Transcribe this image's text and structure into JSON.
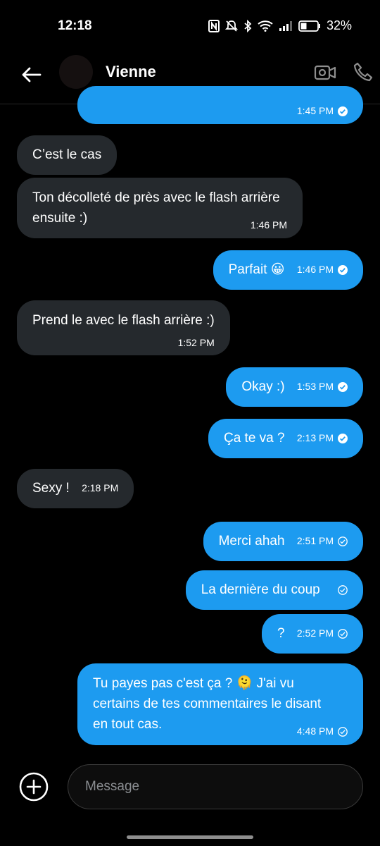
{
  "status": {
    "time": "12:18",
    "battery": "32%"
  },
  "header": {
    "contact_name": "Vienne"
  },
  "messages": [
    {
      "dir": "out",
      "text": "",
      "time": "1:45 PM",
      "read": true
    },
    {
      "dir": "in",
      "text": "C’est le cas",
      "time": ""
    },
    {
      "dir": "in",
      "text": "Ton décolleté de près avec le flash arrière ensuite :)",
      "time": "1:46 PM"
    },
    {
      "dir": "out",
      "text": "Parfait 😀",
      "time": "1:46 PM",
      "read": true
    },
    {
      "dir": "in",
      "text": "Prend le avec le flash arrière :)",
      "time": "1:52 PM"
    },
    {
      "dir": "out",
      "text": "Okay :)",
      "time": "1:53 PM",
      "read": true
    },
    {
      "dir": "out",
      "text": "Ça te va ?",
      "time": "2:13 PM",
      "read": true
    },
    {
      "dir": "in",
      "text": "Sexy !",
      "time": "2:18 PM"
    },
    {
      "dir": "out",
      "text": "Merci ahah",
      "time": "2:51 PM",
      "read": false
    },
    {
      "dir": "out",
      "text": "La dernière du coup",
      "time": "",
      "read": false
    },
    {
      "dir": "out",
      "text": "?",
      "time": "2:52 PM",
      "read": false
    },
    {
      "dir": "out",
      "text": "Tu payes pas c'est ça ? 🫠 J'ai vu certains de tes commentaires le disant en tout cas.",
      "time": "4:48 PM",
      "read": false
    }
  ],
  "composer": {
    "placeholder": "Message"
  },
  "icons": {
    "back": "arrow-left-icon",
    "video": "video-camera-icon",
    "call": "phone-icon",
    "add": "plus-circle-icon",
    "check": "check-circle-icon"
  },
  "colors": {
    "outgoing_bubble": "#1d9bf0",
    "incoming_bubble": "#25292d",
    "background": "#000000"
  }
}
